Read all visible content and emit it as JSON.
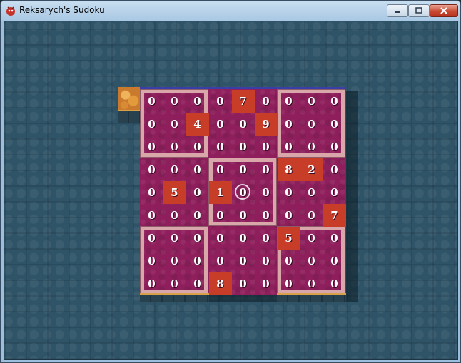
{
  "window": {
    "title": "Reksarych's Sudoku",
    "icon": "sudoku-app-icon"
  },
  "controls": {
    "minimize_icon": "minimize-icon",
    "maximize_icon": "maximize-icon",
    "close_icon": "close-icon"
  },
  "board": {
    "grid": [
      [
        0,
        0,
        0,
        0,
        7,
        0,
        0,
        0,
        0
      ],
      [
        0,
        0,
        4,
        0,
        0,
        9,
        0,
        0,
        0
      ],
      [
        0,
        0,
        0,
        0,
        0,
        0,
        0,
        0,
        0
      ],
      [
        0,
        0,
        0,
        0,
        0,
        0,
        8,
        2,
        0
      ],
      [
        0,
        5,
        0,
        1,
        0,
        0,
        0,
        0,
        0
      ],
      [
        0,
        0,
        0,
        0,
        0,
        0,
        0,
        0,
        7
      ],
      [
        0,
        0,
        0,
        0,
        0,
        0,
        5,
        0,
        0
      ],
      [
        0,
        0,
        0,
        0,
        0,
        0,
        0,
        0,
        0
      ],
      [
        0,
        0,
        0,
        8,
        0,
        0,
        0,
        0,
        0
      ]
    ],
    "given": [
      [
        0,
        4
      ],
      [
        1,
        2
      ],
      [
        1,
        5
      ],
      [
        3,
        6
      ],
      [
        3,
        7
      ],
      [
        4,
        1
      ],
      [
        4,
        3
      ],
      [
        5,
        8
      ],
      [
        6,
        6
      ],
      [
        8,
        3
      ]
    ],
    "selected": [
      4,
      4
    ],
    "framed_boxes": [
      [
        0,
        0
      ],
      [
        0,
        2
      ],
      [
        1,
        1
      ],
      [
        2,
        0
      ],
      [
        2,
        2
      ]
    ]
  },
  "colors": {
    "board": "#8e1f5c",
    "given_cell": "#c73d27",
    "frame": "#d9a6a9",
    "background": "#2f5468"
  }
}
